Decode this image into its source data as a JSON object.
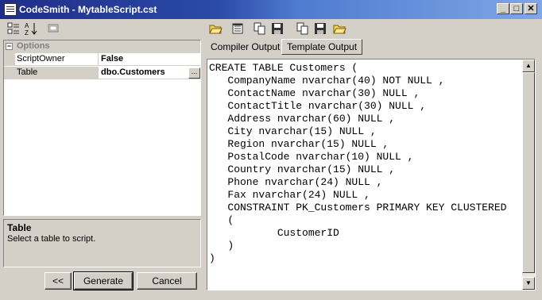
{
  "window": {
    "title": "CodeSmith - MytableScript.cst",
    "controls": {
      "minimize": "_",
      "maximize": "□",
      "close": "✕"
    }
  },
  "left_toolbar": {
    "icons": [
      "categorized-icon",
      "alphabetical-sort-icon",
      "property-pages-icon"
    ]
  },
  "property_grid": {
    "category": "Options",
    "category_toggle": "−",
    "rows": [
      {
        "name": "ScriptOwner",
        "value": "False"
      },
      {
        "name": "Table",
        "value": "dbo.Customers",
        "browse_label": "..."
      }
    ]
  },
  "help": {
    "title": "Table",
    "description": "Select a table to script."
  },
  "buttons": {
    "back": "<<",
    "generate": "Generate",
    "cancel": "Cancel"
  },
  "right_toolbar": {
    "icons": [
      "open-folder-icon",
      "properties-icon",
      "copy-icon",
      "save-icon",
      "copy-icon",
      "save-icon",
      "open-folder-icon"
    ]
  },
  "tabs": [
    {
      "label": "Compiler Output",
      "active": false
    },
    {
      "label": "Template Output",
      "active": true
    }
  ],
  "output": {
    "lines": [
      "CREATE TABLE Customers (",
      "   CompanyName nvarchar(40) NOT NULL ,",
      "   ContactName nvarchar(30) NULL ,",
      "   ContactTitle nvarchar(30) NULL ,",
      "   Address nvarchar(60) NULL ,",
      "   City nvarchar(15) NULL ,",
      "   Region nvarchar(15) NULL ,",
      "   PostalCode nvarchar(10) NULL ,",
      "   Country nvarchar(15) NULL ,",
      "   Phone nvarchar(24) NULL ,",
      "   Fax nvarchar(24) NULL ,",
      "   CONSTRAINT PK_Customers PRIMARY KEY CLUSTERED",
      "   (",
      "           CustomerID",
      "   )",
      ")"
    ]
  },
  "scrollbar": {
    "up": "▲",
    "down": "▼"
  }
}
